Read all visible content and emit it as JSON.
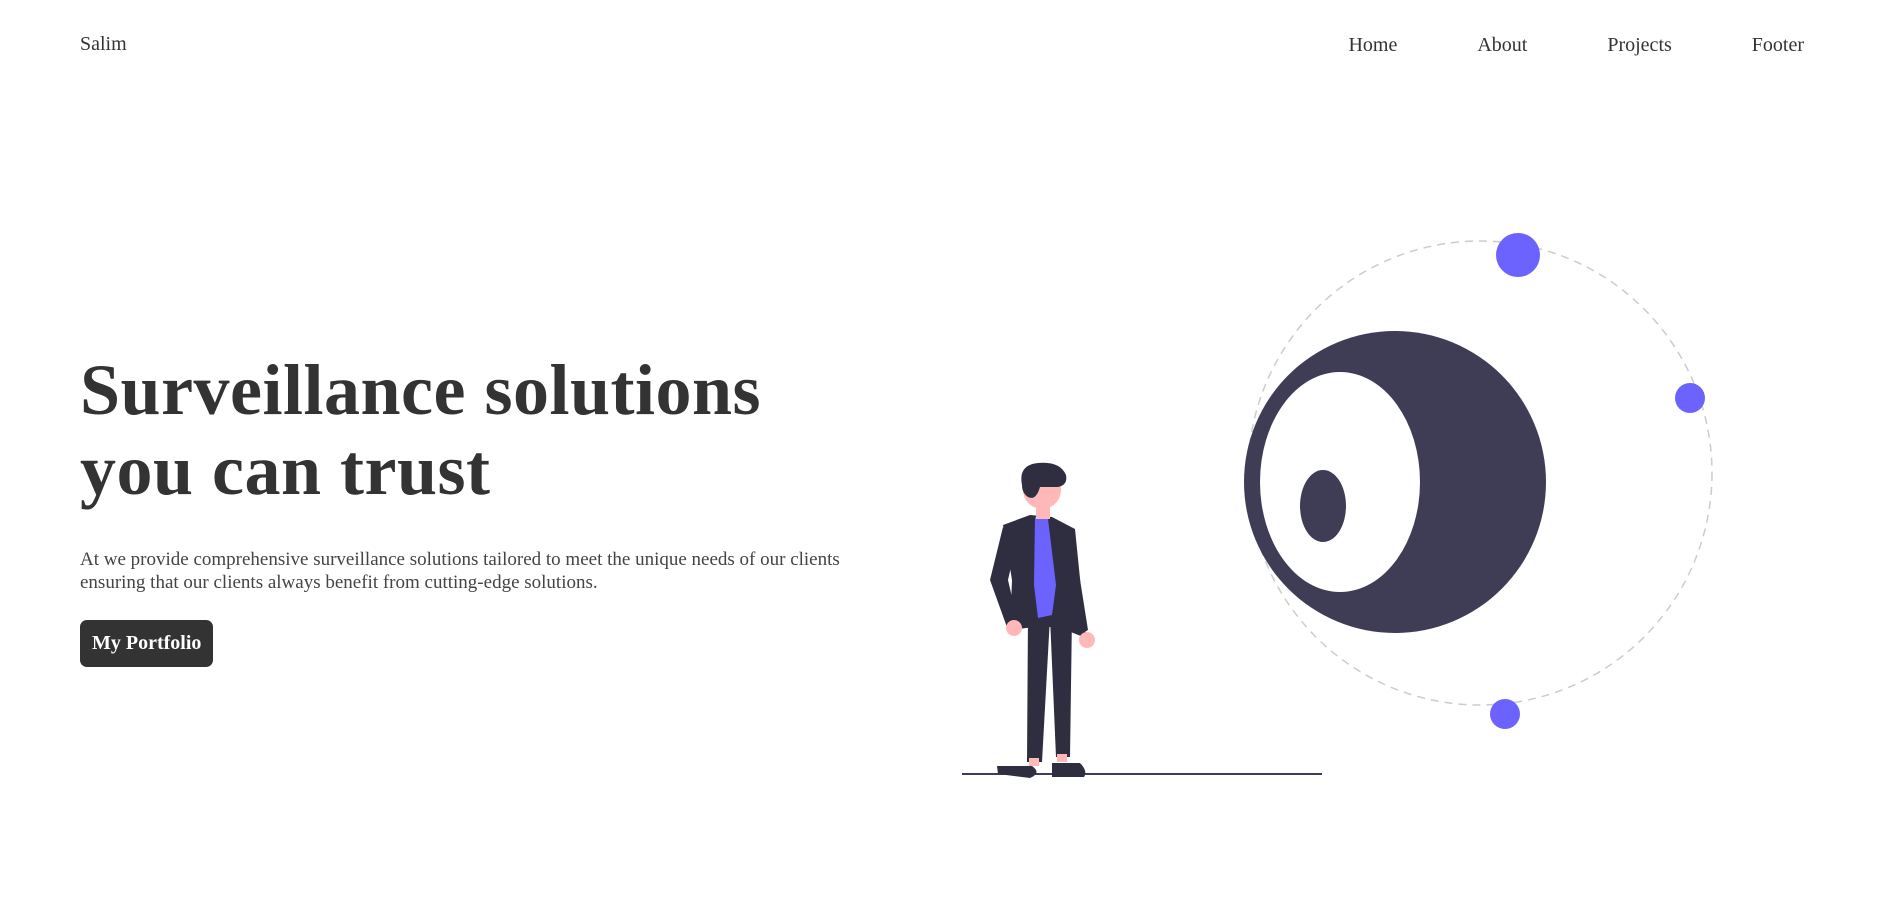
{
  "brand": {
    "name": "Salim"
  },
  "nav": {
    "items": [
      {
        "label": "Home"
      },
      {
        "label": "About"
      },
      {
        "label": "Projects"
      },
      {
        "label": "Footer"
      }
    ]
  },
  "hero": {
    "title_line1": "Surveillance solutions",
    "title_line2": "you can trust",
    "description": "At we provide comprehensive surveillance solutions tailored to meet the unique needs of our clients ensuring that our clients always benefit from cutting-edge solutions.",
    "cta_label": "My Portfolio"
  },
  "illustration": {
    "icon": "person-watching-camera-illustration",
    "colors": {
      "accent": "#6c63ff",
      "dark": "#3f3d56",
      "suit": "#2f2e41",
      "skin": "#ffb8b8",
      "orbit": "#cccccc"
    }
  }
}
